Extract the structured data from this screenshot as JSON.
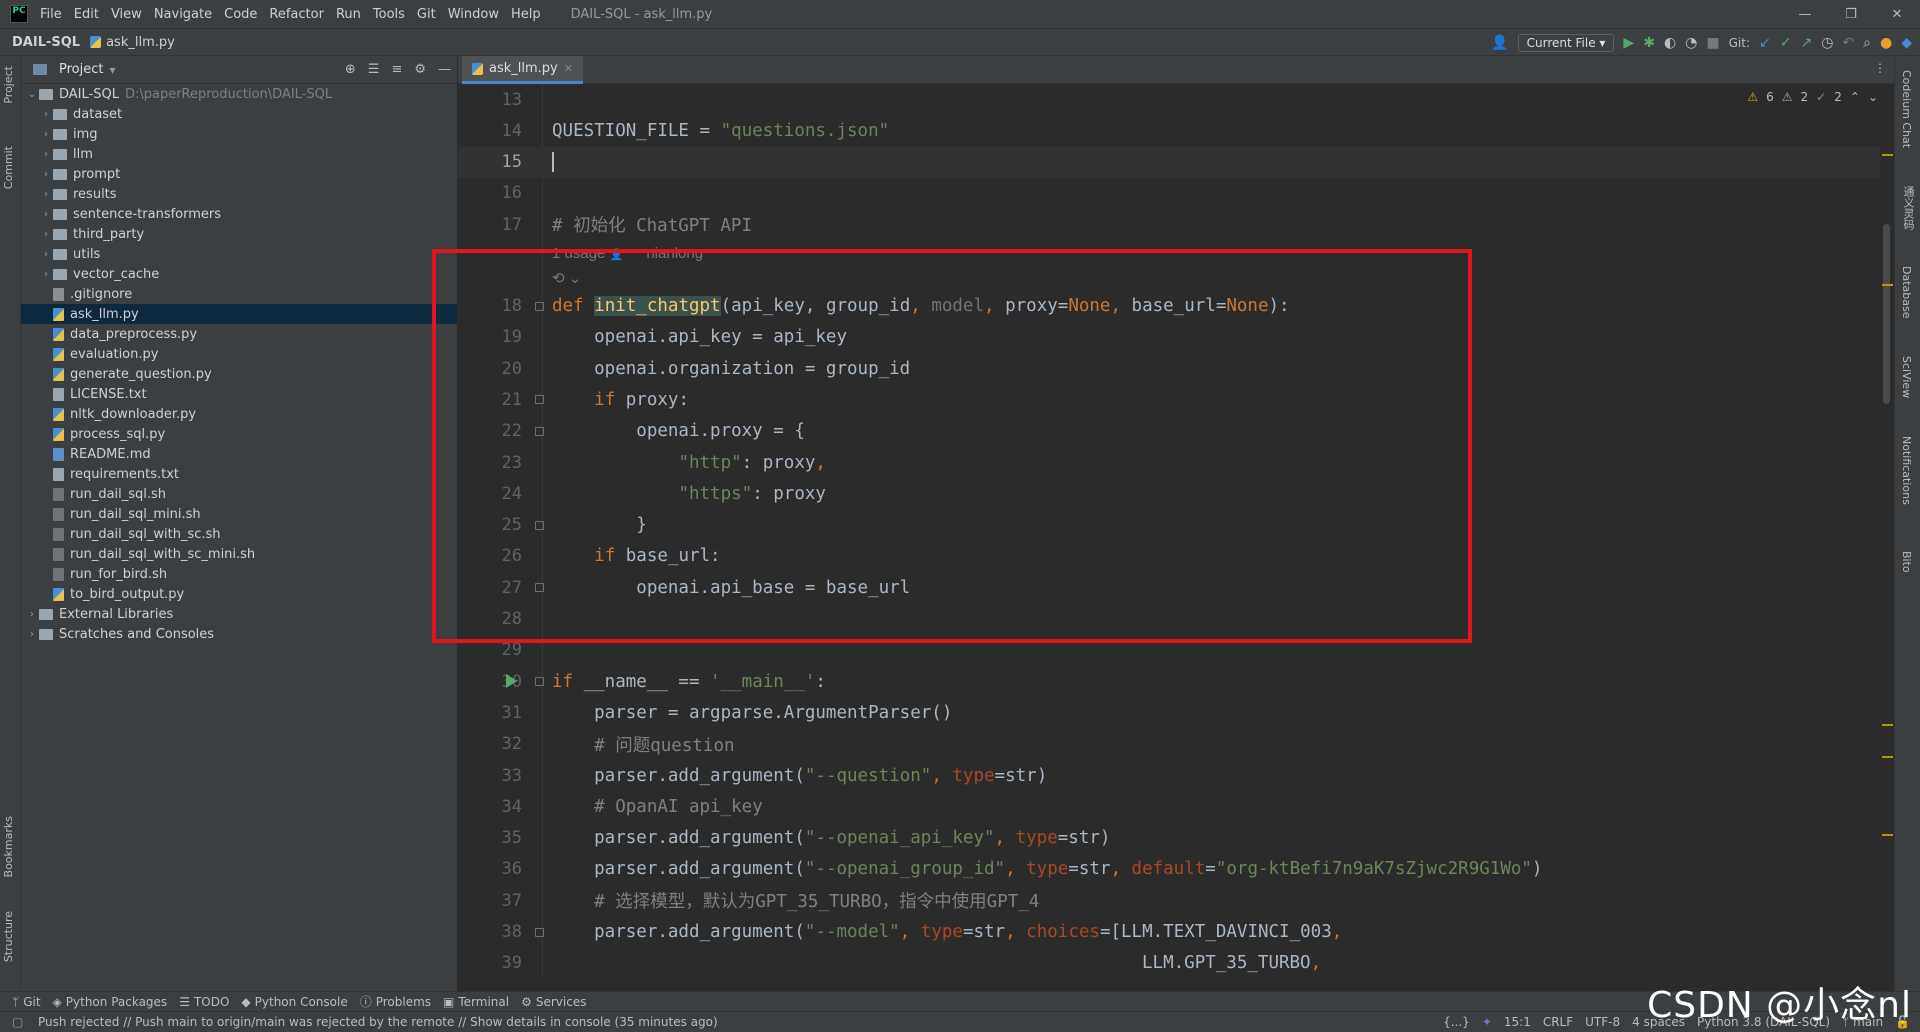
{
  "window": {
    "title": "DAIL-SQL - ask_llm.py",
    "app_logo": "PC",
    "menu": [
      "File",
      "Edit",
      "View",
      "Navigate",
      "Code",
      "Refactor",
      "Run",
      "Tools",
      "Git",
      "Window",
      "Help"
    ],
    "controls": {
      "minimize": "—",
      "restore": "❐",
      "close": "✕"
    }
  },
  "navbar": {
    "project": "DAIL-SQL",
    "file": "ask_llm.py",
    "run_config": "Current File",
    "git_label": "Git:"
  },
  "project_panel": {
    "title": "Project",
    "root_name": "DAIL-SQL",
    "root_path": "D:\\paperReproduction\\DAIL-SQL",
    "folders": [
      "dataset",
      "img",
      "llm",
      "prompt",
      "results",
      "sentence-transformers",
      "third_party",
      "utils",
      "vector_cache"
    ],
    "files": [
      {
        "name": ".gitignore",
        "type": "git"
      },
      {
        "name": "ask_llm.py",
        "type": "py",
        "selected": true
      },
      {
        "name": "data_preprocess.py",
        "type": "py"
      },
      {
        "name": "evaluation.py",
        "type": "py"
      },
      {
        "name": "generate_question.py",
        "type": "py"
      },
      {
        "name": "LICENSE.txt",
        "type": "txt"
      },
      {
        "name": "nltk_downloader.py",
        "type": "py"
      },
      {
        "name": "process_sql.py",
        "type": "py"
      },
      {
        "name": "README.md",
        "type": "md"
      },
      {
        "name": "requirements.txt",
        "type": "txt"
      },
      {
        "name": "run_dail_sql.sh",
        "type": "sh"
      },
      {
        "name": "run_dail_sql_mini.sh",
        "type": "sh"
      },
      {
        "name": "run_dail_sql_with_sc.sh",
        "type": "sh"
      },
      {
        "name": "run_dail_sql_with_sc_mini.sh",
        "type": "sh"
      },
      {
        "name": "run_for_bird.sh",
        "type": "sh"
      },
      {
        "name": "to_bird_output.py",
        "type": "py"
      }
    ],
    "extra": [
      "External Libraries",
      "Scratches and Consoles"
    ]
  },
  "left_tabs": {
    "project": "Project",
    "commit": "Commit",
    "bookmarks": "Bookmarks",
    "structure": "Structure"
  },
  "right_tabs": {
    "codeium": "Codeium Chat",
    "tongyi": "通义灵码",
    "database": "Database",
    "sciview": "SciView",
    "notifications": "Notifications",
    "bito": "Bito"
  },
  "editor": {
    "tab": "ask_llm.py",
    "inspections": {
      "warnings": "6",
      "weak": "2",
      "ok": "2"
    },
    "hint_usage": "1 usage",
    "hint_author": "nianlong",
    "lines": [
      {
        "n": "13",
        "html": ""
      },
      {
        "n": "14",
        "html": "QUESTION_FILE = <span class='str'>\"questions.json\"</span>"
      },
      {
        "n": "15",
        "html": "<span class='caret'></span>",
        "current": true
      },
      {
        "n": "16",
        "html": ""
      },
      {
        "n": "17",
        "html": "<span class='cmt'># 初始化 ChatGPT API</span>"
      },
      {
        "n": "18",
        "html": "<span class='kw'>def </span><span class='fn'>init_chatgpt</span>(api_key, group_id<span class='kw'>, </span><span class='dim'>model</span><span class='kw'>, </span>proxy=<span class='kw'>None, </span>base_url=<span class='kw'>None</span>):",
        "fold": true
      },
      {
        "n": "19",
        "html": "    openai.api_key = api_key"
      },
      {
        "n": "20",
        "html": "    openai.organization = group_id"
      },
      {
        "n": "21",
        "html": "    <span class='kw'>if </span>proxy:",
        "fold": true
      },
      {
        "n": "22",
        "html": "        openai.proxy = {",
        "fold": true
      },
      {
        "n": "23",
        "html": "            <span class='str'>\"http\"</span>: proxy<span class='kw'>,</span>"
      },
      {
        "n": "24",
        "html": "            <span class='str'>\"https\"</span>: proxy"
      },
      {
        "n": "25",
        "html": "        }",
        "fold": true
      },
      {
        "n": "26",
        "html": "    <span class='kw'>if </span>base_url:"
      },
      {
        "n": "27",
        "html": "        openai.api_base = base_url",
        "fold": true
      },
      {
        "n": "28",
        "html": ""
      },
      {
        "n": "29",
        "html": ""
      },
      {
        "n": "30",
        "html": "<span class='kw'>if </span>__name__ == <span class='str'>'__main__'</span>:",
        "fold": true,
        "run": true
      },
      {
        "n": "31",
        "html": "    parser = argparse.ArgumentParser()"
      },
      {
        "n": "32",
        "html": "    <span class='cmt'># 问题question</span>"
      },
      {
        "n": "33",
        "html": "    parser.add_argument(<span class='str'>\"--question\"</span><span class='kw'>, </span><span style='color:#aa4926'>type</span>=str)"
      },
      {
        "n": "34",
        "html": "    <span class='cmt'># OpanAI api_key</span>"
      },
      {
        "n": "35",
        "html": "    parser.add_argument(<span class='str'>\"--openai_api_key\"</span><span class='kw'>, </span><span style='color:#aa4926'>type</span>=str)"
      },
      {
        "n": "36",
        "html": "    parser.add_argument(<span class='str'>\"--openai_group_id\"</span><span class='kw'>, </span><span style='color:#aa4926'>type</span>=str<span class='kw'>, </span><span style='color:#aa4926'>default</span>=<span class='str'>\"org-ktBefi7n9aK7sZjwc2R9G1Wo\"</span>)"
      },
      {
        "n": "37",
        "html": "    <span class='cmt'># 选择模型，默认为GPT_35_TURBO，指令中使用GPT_4</span>"
      },
      {
        "n": "38",
        "html": "    parser.add_argument(<span class='str'>\"--model\"</span><span class='kw'>, </span><span style='color:#aa4926'>type</span>=str<span class='kw'>, </span><span style='color:#aa4926'>choices</span>=[LLM.TEXT_DAVINCI_003<span class='kw'>,</span>",
        "fold": true
      },
      {
        "n": "39",
        "html": "                                                        LLM.GPT_35_TURBO<span class='kw'>,</span>"
      }
    ]
  },
  "bottom_tabs": [
    "Git",
    "Python Packages",
    "TODO",
    "Python Console",
    "Problems",
    "Terminal",
    "Services"
  ],
  "status": {
    "message": "Push rejected // Push main to origin/main was rejected by the remote // Show details in console (35 minutes ago)",
    "braces": "{...}",
    "position": "15:1",
    "line_sep": "CRLF",
    "encoding": "UTF-8",
    "indent": "4 spaces",
    "interpreter": "Python 3.8 (DAIL-SQL)",
    "branch": "main"
  },
  "watermark": "CSDN @小念nl"
}
